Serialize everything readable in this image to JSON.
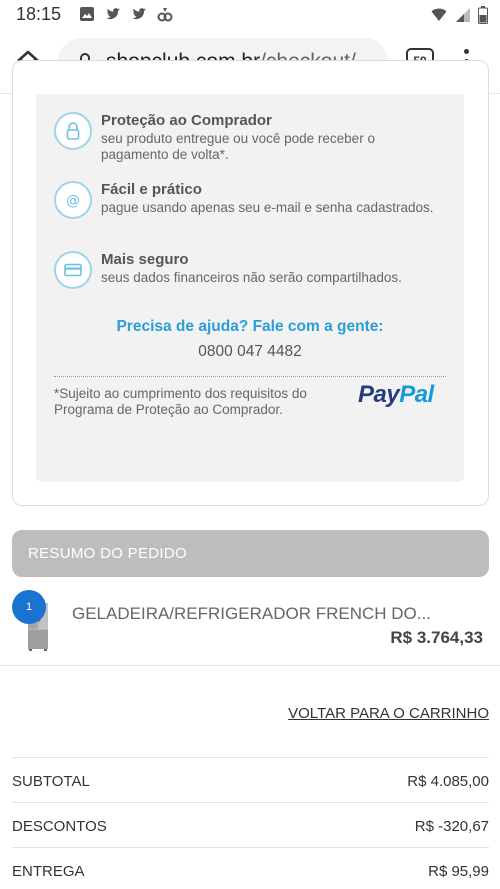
{
  "status_bar": {
    "time": "18:15",
    "left_icons": [
      "image-icon",
      "twitter-icon",
      "twitter-icon",
      "recycle-icon"
    ],
    "right_icons": [
      "wifi-icon",
      "signal-icon",
      "battery-icon"
    ]
  },
  "browser": {
    "url_domain": "shopclub.com.br",
    "url_path": "/checkout/",
    "tab_count": "59"
  },
  "paypal_card": {
    "benefits": [
      {
        "icon": "lock-icon",
        "title": "Proteção ao Comprador",
        "text": "seu produto entregue ou você pode receber o pagamento de volta*."
      },
      {
        "icon": "at-icon",
        "title": "Fácil e prático",
        "text": "pague usando apenas seu e-mail e senha cadastrados."
      },
      {
        "icon": "card-icon",
        "title": "Mais seguro",
        "text": "seus dados financeiros não serão compartilhados."
      }
    ],
    "help_title": "Precisa de ajuda? Fale com a gente:",
    "help_phone": "0800 047 4482",
    "disclaimer": "*Sujeito ao cumprimento dos requisitos do Programa de Proteção ao Comprador.",
    "logo_part1": "Pay",
    "logo_part2": "Pal",
    "colors": {
      "accent": "#2a9fd6",
      "paypal_dark": "#253b80",
      "paypal_light": "#179bd7"
    }
  },
  "summary": {
    "header": "RESUMO DO PEDIDO",
    "item": {
      "quantity": "1",
      "name": "GELADEIRA/REFRIGERADOR FRENCH DO...",
      "price": "R$ 3.764,33"
    },
    "back_link": "VOLTAR PARA O CARRINHO",
    "totals": [
      {
        "label": "SUBTOTAL",
        "value": "R$ 4.085,00"
      },
      {
        "label": "DESCONTOS",
        "value": "R$ -320,67"
      },
      {
        "label": "ENTREGA",
        "value": "R$ 95,99"
      }
    ]
  }
}
